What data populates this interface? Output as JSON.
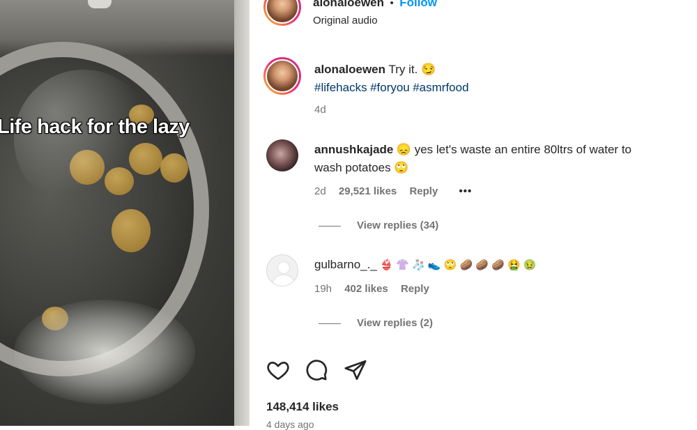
{
  "video": {
    "overlay_text": "Life hack for the lazy"
  },
  "header": {
    "username": "alonaloewen",
    "separator": "•",
    "follow_label": "Follow",
    "audio_label": "Original audio"
  },
  "caption": {
    "username": "alonaloewen",
    "text": "Try it. 😏",
    "hashtags": [
      "#lifehacks",
      "#foryou",
      "#asmrfood"
    ],
    "time": "4d"
  },
  "comments": [
    {
      "username": "annushkajade",
      "text_line1": "😞 yes let's waste an entire 80ltrs of water to",
      "text_line2": "wash potatoes 🙄",
      "time": "2d",
      "likes": "29,521 likes",
      "reply_label": "Reply",
      "more_label": "•••",
      "view_replies": "View replies (34)"
    },
    {
      "username": "gulbarno_._",
      "text": "👙 👚 🧦 👟 🙄 🥔 🥔 🥔 🤮 🤢",
      "time": "19h",
      "likes": "402 likes",
      "reply_label": "Reply",
      "view_replies": "View replies (2)"
    }
  ],
  "actions": {
    "like_icon": "heart-icon",
    "comment_icon": "comment-icon",
    "share_icon": "share-icon"
  },
  "post_likes": "148,414 likes",
  "post_time": "4 days ago",
  "colors": {
    "link": "#00376b",
    "follow": "#0095f6",
    "muted": "#737373"
  }
}
